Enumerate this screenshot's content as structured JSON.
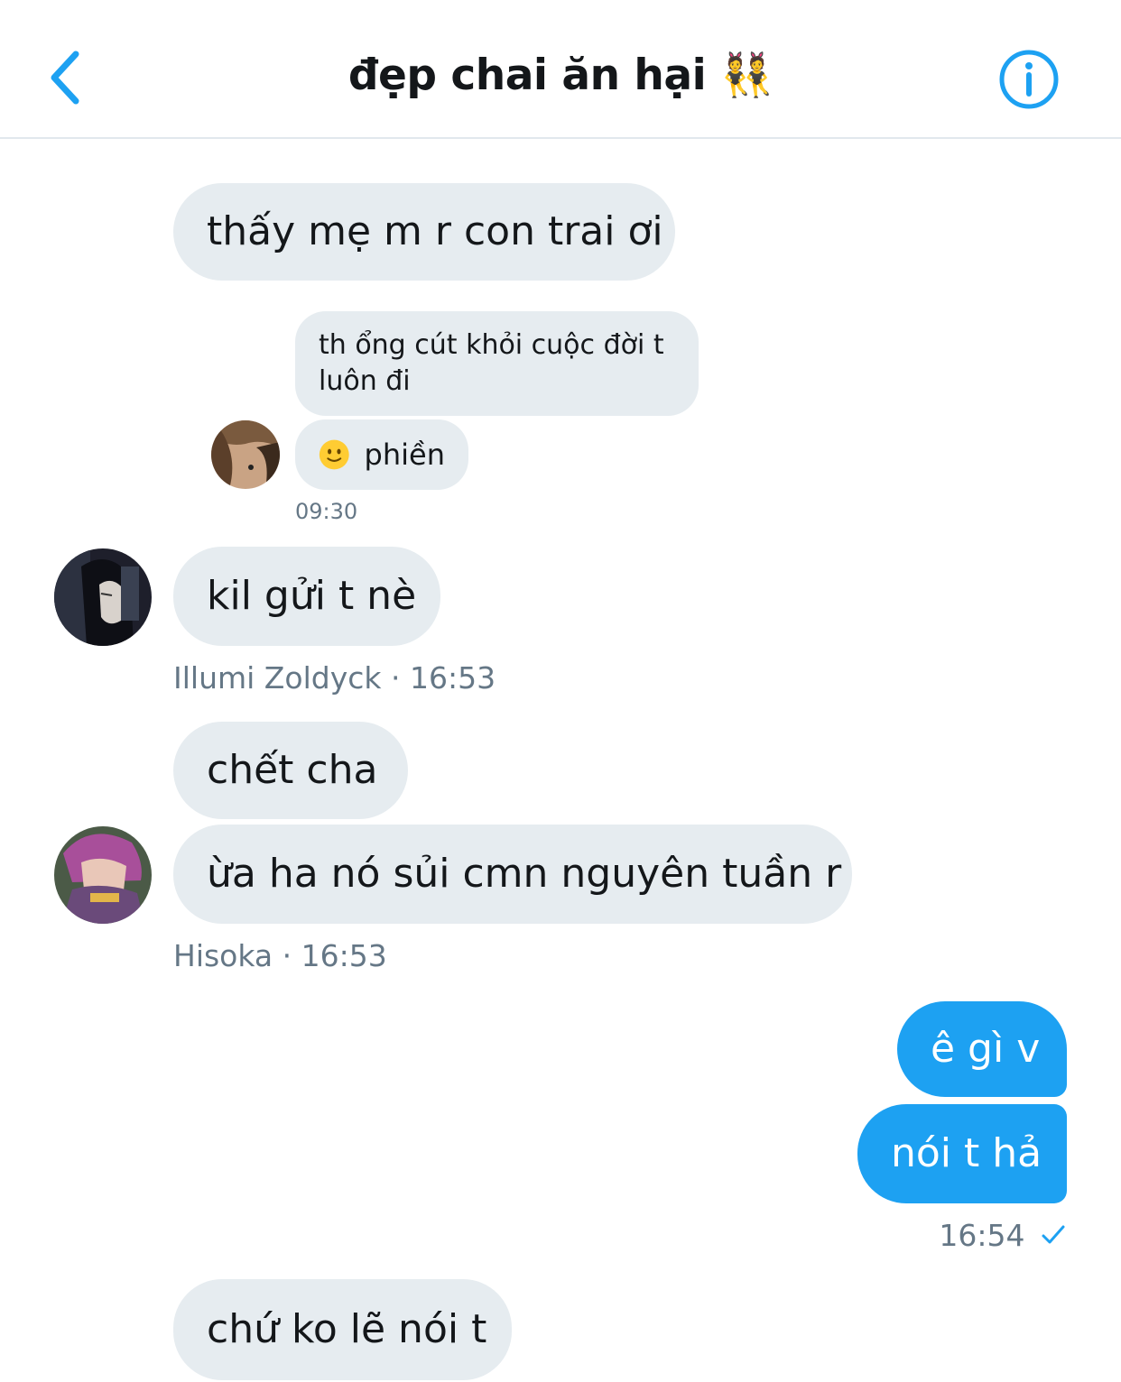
{
  "header": {
    "title": "đẹp chai ăn hại",
    "title_emoji": "👯",
    "back_icon": "chevron-left-icon",
    "info_icon": "info-icon",
    "accent": "#1da1f2"
  },
  "messages": [
    {
      "text": "thấy mẹ m r con trai ơi",
      "from": "other"
    },
    {
      "text": "th ổng cút khỏi cuộc đời t luôn đi",
      "type": "shared"
    },
    {
      "text": "phiền",
      "type": "shared-reply"
    },
    {
      "time": "09:30"
    },
    {
      "text": "kil gửi t nè",
      "from": "other"
    },
    {
      "sender": "Illumi Zoldyck",
      "time": "16:53"
    },
    {
      "text": "chết cha",
      "from": "other"
    },
    {
      "text": "ừa ha nó sủi cmn nguyên tuần r",
      "from": "other"
    },
    {
      "sender": "Hisoka",
      "time": "16:53"
    },
    {
      "text": "ê gì v",
      "from": "me"
    },
    {
      "text": "nói t hả",
      "from": "me"
    },
    {
      "time": "16:54",
      "status_icon": "checkmark-icon"
    },
    {
      "text": "chứ ko lẽ nói t",
      "from": "other"
    }
  ],
  "colors": {
    "incoming_bubble": "#e6ecf0",
    "outgoing_bubble": "#1da1f2",
    "meta_text": "#657786"
  }
}
